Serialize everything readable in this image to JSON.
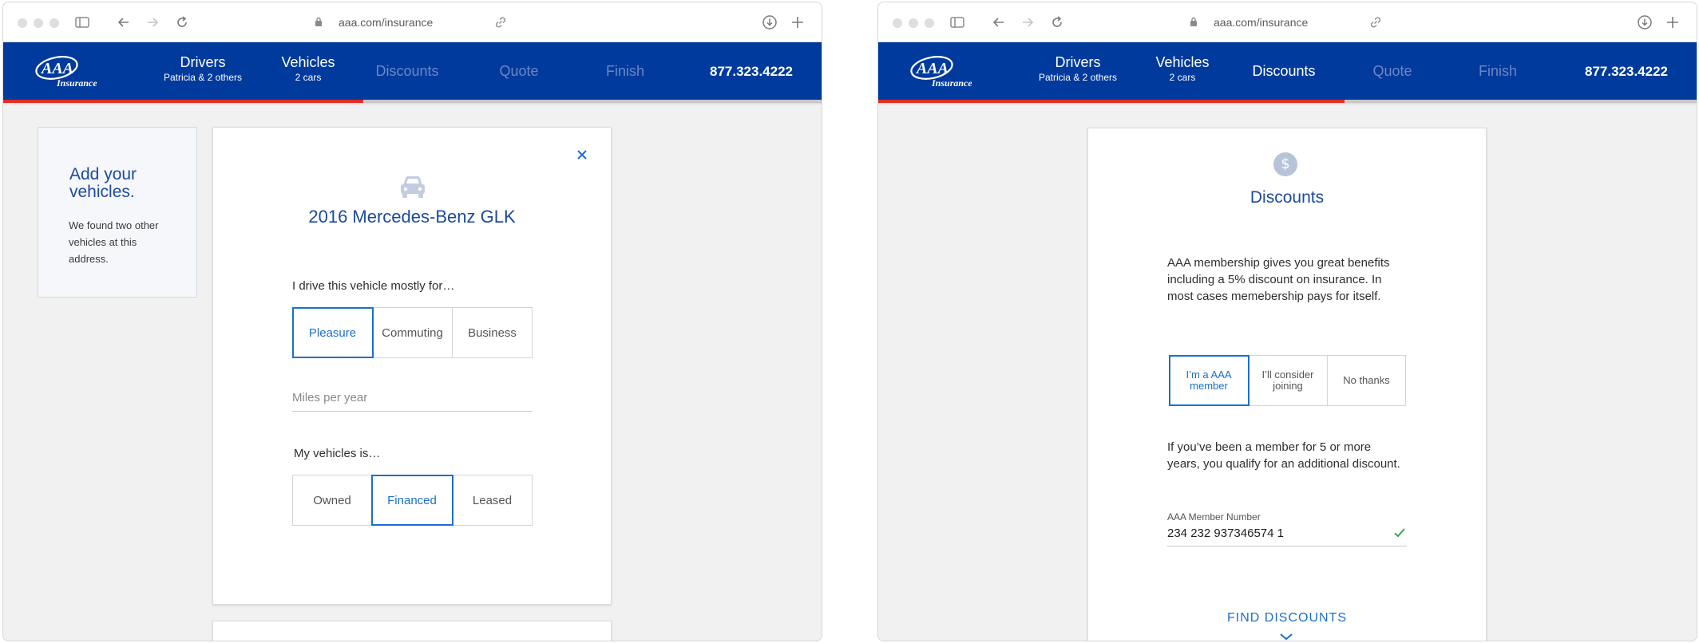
{
  "browser": {
    "url": "aaa.com/insurance"
  },
  "header": {
    "logo_text": "AAA",
    "logo_subtext": "Insurance",
    "phone": "877.323.4222",
    "nav": [
      {
        "label": "Drivers",
        "sub": "Patricia & 2 others"
      },
      {
        "label": "Vehicles",
        "sub": "2 cars"
      },
      {
        "label": "Discounts"
      },
      {
        "label": "Quote"
      },
      {
        "label": "Finish"
      }
    ]
  },
  "colors": {
    "brand_blue": "#003a9c",
    "accent_red": "#e22d25",
    "link_blue": "#1a6fd0",
    "heading_blue": "#1c4aa0"
  },
  "left_screen": {
    "progress": 0.44,
    "side_panel": {
      "title": "Add your vehicles.",
      "text": "We found two other vehicles at this address."
    },
    "vehicle_card": {
      "title": "2016 Mercedes-Benz GLK",
      "usage_label": "I drive this vehicle mostly for…",
      "usage_options": [
        "Pleasure",
        "Commuting",
        "Business"
      ],
      "usage_selected": "Pleasure",
      "miles_placeholder": "Miles per year",
      "ownership_label": "My vehicles is…",
      "ownership_options": [
        "Owned",
        "Financed",
        "Leased"
      ],
      "ownership_selected": "Financed"
    }
  },
  "right_screen": {
    "progress": 0.57,
    "discount_card": {
      "title": "Discounts",
      "intro": "AAA membership gives you great benefits including a 5% discount on insurance. In most cases memebership pays for itself.",
      "membership_options": [
        "I’m a AAA member",
        "I’ll consider joining",
        "No thanks"
      ],
      "membership_selected": "I’m a AAA member",
      "followup": "If you’ve been a member for 5 or more years, you qualify for an additional discount.",
      "member_number_label": "AAA Member Number",
      "member_number_value": "234 232 937346574 1",
      "find_button": "FIND DISCOUNTS"
    }
  }
}
